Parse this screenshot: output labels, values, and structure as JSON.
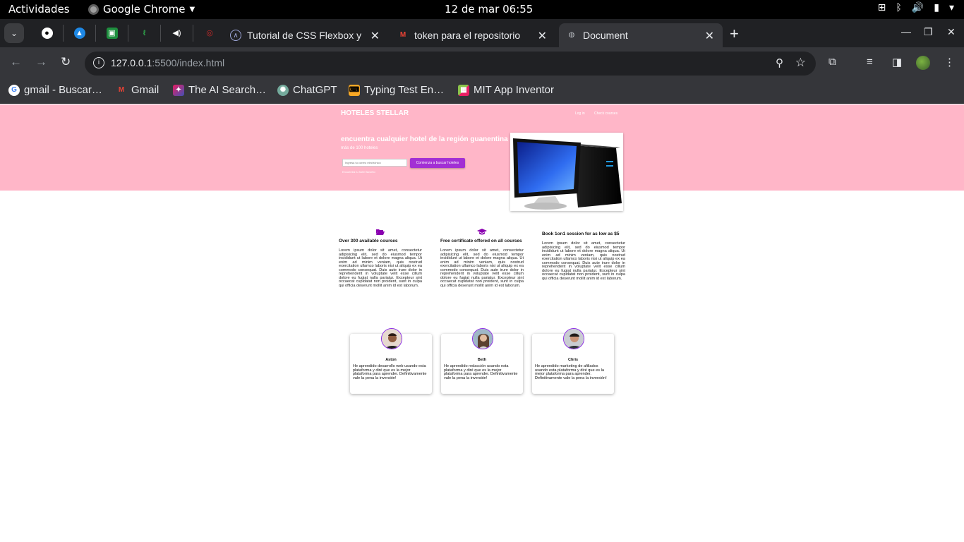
{
  "os_bar": {
    "activities": "Actividades",
    "app_name": "Google Chrome",
    "clock": "12 de mar  06:55"
  },
  "browser": {
    "tabs": [
      {
        "title": "Tutorial de CSS Flexbox y",
        "favicon": "vite-icon"
      },
      {
        "title": "token para el repositorio",
        "favicon": "gmail-icon"
      },
      {
        "title": "Document",
        "favicon": "globe-icon",
        "active": true
      }
    ],
    "url_host": "127.0.0.1",
    "url_rest": ":5500/index.html",
    "bookmarks": [
      {
        "label": "gmail - Buscar…",
        "favicon": "google-icon"
      },
      {
        "label": "Gmail",
        "favicon": "gmail-icon"
      },
      {
        "label": "The AI Search…",
        "favicon": "ai-search-icon"
      },
      {
        "label": "ChatGPT",
        "favicon": "chatgpt-icon"
      },
      {
        "label": "Typing Test En…",
        "favicon": "typing-icon"
      },
      {
        "label": "MIT App Inventor",
        "favicon": "app-inventor-icon"
      }
    ]
  },
  "page": {
    "brand": "HOTELES STELLAR",
    "nav": [
      "Log in",
      "Check courses"
    ],
    "hero_title": "encuentra cualquier hotel de la región guanentina",
    "hero_subtitle": "más de 100 hoteles",
    "email_placeholder": "Ingresa tu correo electrónico",
    "cta_label": "Comienza a buscar hoteles",
    "hero_note": "Encuentra tu hotel favorito",
    "features": [
      {
        "icon": "folder-open-icon",
        "title": "Over 300 available courses",
        "text": "Lorem ipsum dolor sit amet, consectetur adipisicing elit, sed do eiusmod tempor incididunt ut labore et dolore magna aliqua. Ut enim ad minim veniam, quis nostrud exercitation ullamco laboris nisi ut aliquip ex ea commodo consequat. Duis aute irure dolor in reprehenderit in voluptate velit esse cillum dolore eu fugiat nulla pariatur. Excepteur sint occaecat cupidatat non proident, sunt in culpa qui officia deserunt mollit anim id est laborum."
      },
      {
        "icon": "graduation-cap-icon",
        "title": "Free certificate offered on all courses",
        "text": "Lorem ipsum dolor sit amet, consectetur adipisicing elit, sed do eiusmod tempor incididunt ut labore et dolore magna aliqua. Ut enim ad minim veniam, quis nostrud exercitation ullamco laboris nisi ut aliquip ex ea commodo consequat. Duis aute irure dolor in reprehenderit in voluptate velit esse cillum dolore eu fugiat nulla pariatur. Excepteur sint occaecat cupidatat non proident, sunt in culpa qui officia deserunt mollit anim id est laborum."
      },
      {
        "icon": "",
        "title": "Book 1on1 session for as low as $5",
        "text": "Lorem ipsum dolor sit amet, consectetur adipisicing elit, sed do eiusmod tempor incididunt ut labore et dolore magna aliqua. Ut enim ad minim veniam, quis nostrud exercitation ullamco laboris nisi ut aliquip ex ea commodo consequat. Duis aute irure dolor in reprehenderit in voluptate velit esse cillum dolore eu fugiat nulla pariatur. Excepteur sint occaecat cupidatat non proident, sunt in culpa qui officia deserunt mollit anim id est laborum."
      }
    ],
    "testimonials": [
      {
        "name": "Aston",
        "text": "He aprendido desarrollo web usando esta plataforma y diré que es la mejor plataforma para aprender. Definitivamente vale la pena la inversión!"
      },
      {
        "name": "Beth",
        "text": "He aprendido redacción usando esta plataforma y diré que es la mejor plataforma para aprender. Definitivamente vale la pena la inversión!"
      },
      {
        "name": "Chris",
        "text": "He aprendido marketing de afiliados usando esta plataforma y diré que es la mejor plataforma para aprender. Definitivamente vale la pena la inversión!"
      }
    ],
    "colors": {
      "hero_bg": "#ffb6c8",
      "accent": "#a22fd4",
      "icon": "#8a00b0"
    }
  }
}
